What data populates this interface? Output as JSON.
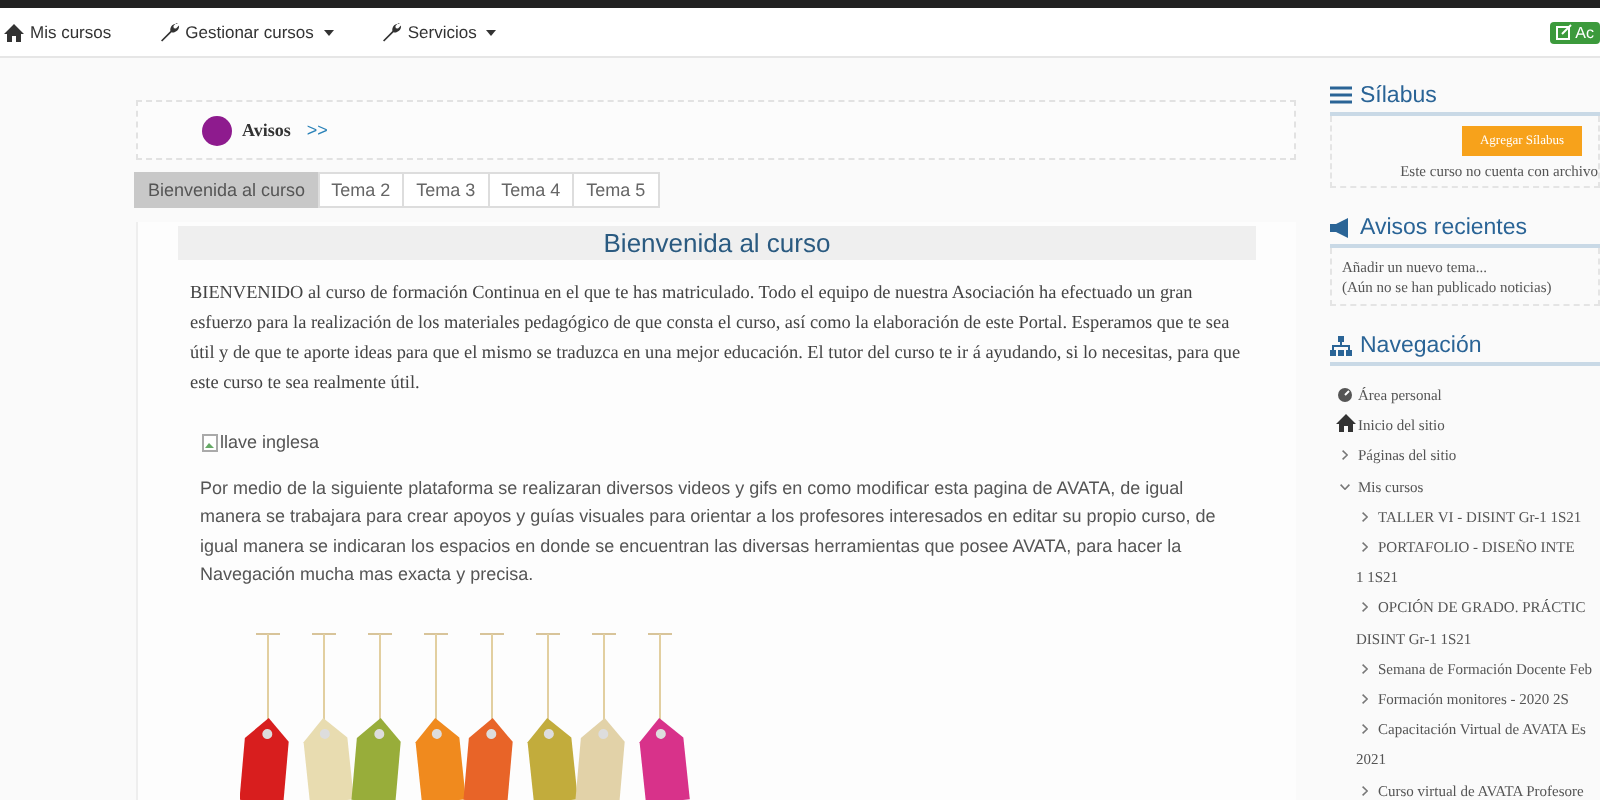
{
  "navbar": {
    "items": [
      {
        "label": "Mis cursos",
        "caret": false
      },
      {
        "label": "Gestionar cursos",
        "caret": true
      },
      {
        "label": "Servicios",
        "caret": true
      }
    ],
    "edit_button": "Ac"
  },
  "avisos_link": {
    "label": "Avisos",
    "arrow": ">>"
  },
  "tabs": [
    {
      "label": "Bienvenida al curso",
      "selected": true
    },
    {
      "label": "Tema 2",
      "selected": false
    },
    {
      "label": "Tema 3",
      "selected": false
    },
    {
      "label": "Tema 4",
      "selected": false
    },
    {
      "label": "Tema 5",
      "selected": false
    }
  ],
  "section": {
    "title": "Bienvenida al curso",
    "intro": "BIENVENIDO al curso de formación Continua en el que te has matriculado. Todo el equipo de nuestra Asociación ha efectuado un gran esfuerzo para la realización de los materiales pedagógico de que consta el curso, así como la elaboración de este Portal. Esperamos que te sea útil y de que te aporte ideas para que el mismo se traduzca en una mejor educación. El tutor del curso te ir á ayudando, si lo necesitas, para que este curso te sea realmente útil.",
    "image_alt": "llave inglesa",
    "description": "Por medio de la siguiente plataforma se realizaran diversos videos y gifs en como modificar esta pagina de AVATA, de igual manera se trabajara para crear apoyos y guías visuales para orientar a los profesores interesados en editar su propio curso, de igual manera se indicaran los espacios en donde se encuentran las diversas herramientas que posee AVATA, para hacer la Navegación mucha mas exacta y precisa."
  },
  "sidebar": {
    "silabus": {
      "title": "Sílabus",
      "button": "Agregar Sílabus",
      "note": "Este curso no cuenta con archivo"
    },
    "avisos": {
      "title": "Avisos recientes",
      "lines": [
        "Añadir un nuevo tema...",
        "(Aún no se han publicado noticias)"
      ]
    },
    "navegacion": {
      "title": "Navegación",
      "items": [
        {
          "label": "Área personal",
          "kind": "dashboard"
        },
        {
          "label": "Inicio del sitio",
          "kind": "home"
        },
        {
          "label": "Páginas del sitio",
          "kind": "branch",
          "expanded": false
        },
        {
          "label": "Mis cursos",
          "kind": "branch",
          "expanded": true,
          "children": [
            {
              "label": "TALLER VI - DISINT Gr-1 1S21"
            },
            {
              "label": "PORTAFOLIO - DISEÑO INTE",
              "continuation": "1 1S21"
            },
            {
              "label": "OPCIÓN DE GRADO. PRÁCTIC",
              "continuation": "DISINT Gr-1 1S21"
            },
            {
              "label": "Semana de Formación Docente Feb"
            },
            {
              "label": "Formación monitores - 2020 2S"
            },
            {
              "label": "Capacitación Virtual de AVATA Es",
              "continuation": "2021"
            },
            {
              "label": "Curso virtual de AVATA Profesore"
            }
          ]
        }
      ]
    }
  }
}
